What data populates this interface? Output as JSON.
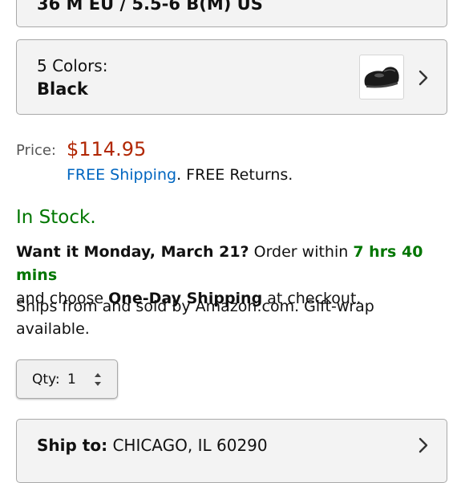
{
  "size_selector": {
    "value": "36 M EU / 5.5-6 B(M) US"
  },
  "color_selector": {
    "label": "5 Colors:",
    "value": "Black",
    "thumbnail_icon": "black-clog-shoe-icon",
    "chevron_icon": "chevron-right-icon"
  },
  "price": {
    "label": "Price:",
    "value": "$114.95",
    "shipping_link": "FREE Shipping",
    "returns_text": ". FREE Returns."
  },
  "stock": {
    "status": "In Stock."
  },
  "delivery": {
    "headline": "Want it Monday, March 21?",
    "order_within": " Order within ",
    "time_left": "7 hrs 40 mins",
    "and_choose": "and choose ",
    "shipping_option": "One-Day Shipping",
    "at_checkout": " at checkout."
  },
  "seller": {
    "text": "Ships from and sold by Amazon.com. Gift-wrap available."
  },
  "quantity": {
    "label": "Qty:",
    "value": "1",
    "stepper_icon": "up-down-arrows-icon"
  },
  "ship_to": {
    "label": "Ship to:",
    "location": "CHICAGO, IL 60290",
    "chevron_icon": "chevron-right-icon"
  },
  "colors": {
    "price_red": "#b12704",
    "stock_green": "#007600",
    "link_blue": "#0066c0"
  }
}
